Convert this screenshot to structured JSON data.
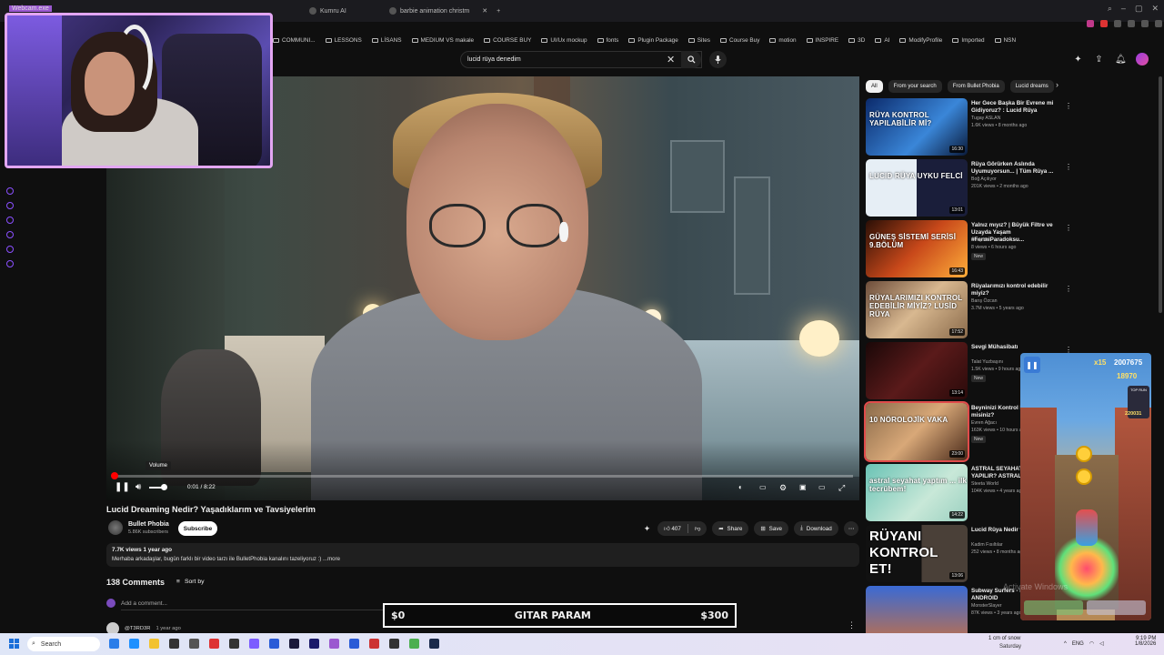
{
  "browser": {
    "tabs": [
      {
        "label": "Webcam.exe"
      },
      {
        "label": "Kumru AI"
      },
      {
        "label": "barbie animation christm"
      }
    ],
    "bookmarks": [
      "COMMUNI...",
      "LESSONS",
      "LİSANS",
      "MEDIUM VS makale",
      "COURSE BUY",
      "UI/Ux mockup",
      "fonts",
      "Plugin Package",
      "Sites",
      "Course Buy",
      "motion",
      "INSPIRE",
      "3D",
      "AI",
      "ModifyProfile",
      "Imported",
      "NSN"
    ]
  },
  "search": {
    "query": "lucid rüya denedim"
  },
  "video": {
    "volume_tooltip": "Volume",
    "timecode": "0:01 / 8:22",
    "progress_fraction": 0.002,
    "title": "Lucid Dreaming Nedir? Yaşadıklarım ve Tavsiyelerim",
    "channel": "Bullet Phobia",
    "subscribers": "5.86K subscribers",
    "subscribe_label": "Subscribe",
    "likes": "407",
    "share_label": "Share",
    "save_label": "Save",
    "download_label": "Download",
    "desc_meta": "7.7K views  1 year ago",
    "desc_text": "Merhaba arkadaşlar, bugün farklı bir video tarzı ile BulletPhobia kanalını tazeliyoruz :)  ...more"
  },
  "comments": {
    "count": "138 Comments",
    "sort_label": "Sort by",
    "add_placeholder": "Add a comment...",
    "first_user": "@T3RD3R",
    "first_time": "1 year ago"
  },
  "chips": [
    "All",
    "From your search",
    "From Bullet Phobia",
    "Lucid dreams"
  ],
  "recommendations": [
    {
      "title": "Her Gece Başka Bir Evrene mi Gidiyoruz? : Lucid Rüya",
      "channel": "Tugay ASLAN",
      "meta": "1.6K views • 8 months ago",
      "duration": "16:30",
      "thumb_text": "RÜYA KONTROL YAPILABİLİR Mİ?",
      "new": ""
    },
    {
      "title": "Rüya Görürken Aslında Uyumuyorsun... | Tüm Rüya ...",
      "channel": "Boğ Açılıyor",
      "meta": "201K views • 2 months ago",
      "duration": "13:01",
      "thumb_text": "LUCID RÜYA   UYKU FELCİ",
      "new": ""
    },
    {
      "title": "Yalnız mıyız? | Büyük Filtre ve Uzayda Yaşam #FermiParadoksu...",
      "channel": "Uzay Ve",
      "meta": "8 views • 6 hours ago",
      "duration": "16:43",
      "thumb_text": "GÜNEŞ SİSTEMİ SERİSİ 9.BÖLÜM",
      "new": "New"
    },
    {
      "title": "Rüyalarımızı kontrol edebilir miyiz?",
      "channel": "Barış Özcan",
      "meta": "3.7M views • 5 years ago",
      "duration": "17:52",
      "thumb_text": "RÜYALARIMIZI KONTROL EDEBİLİR MİYİZ? LUSİD RÜYA",
      "new": ""
    },
    {
      "title": "Sevgi Mühasibatı",
      "channel": "Talat Yuzbaşını",
      "meta": "1.5K views • 9 hours ago",
      "duration": "13:14",
      "thumb_text": "",
      "new": "New"
    },
    {
      "title": "Beyninizi Kontrol Etmek Emin misiniz?",
      "channel": "Evren Ağacı",
      "meta": "163K views • 10 hours ago",
      "duration": "23:00",
      "thumb_text": "10 NÖROLOJİK VAKA",
      "new": "New"
    },
    {
      "title": "ASTRAL SEYAHAT NASIL YAPILIR? ASTRAL SEYAHAT ...",
      "channel": "Steeta World",
      "meta": "104K views • 4 years ago",
      "duration": "14:22",
      "thumb_text": "astral seyahat yaptım ... ilk tecrübem!",
      "new": ""
    },
    {
      "title": "Lucid Rüya Nedir ve Nasıl ...",
      "channel": "Kadim Fısıltılar",
      "meta": "252 views • 8 months ago",
      "duration": "13:06",
      "thumb_text": "RÜYANI KONTROL ET!",
      "new": ""
    },
    {
      "title": "Subway Surfers - High Score | ANDROID",
      "channel": "MonsterSlayer",
      "meta": "87K views • 3 years ago",
      "duration": "",
      "thumb_text": "",
      "new": ""
    }
  ],
  "webcam": {
    "label": "Webcam.exe"
  },
  "game": {
    "multiplier": "x15",
    "score": "2007675",
    "coins": "18970",
    "top_label": "TOP RUN",
    "top_score": "220031"
  },
  "watermark": "Activate Windows",
  "gitar": {
    "left": "$0",
    "center": "GITAR PARAM",
    "right": "$300"
  },
  "taskbar": {
    "search_label": "Search",
    "weather": "1 cm of snow",
    "weather_day": "Saturday",
    "lang": "ENG",
    "time": "9:19 PM",
    "date": "1/8/2026"
  }
}
